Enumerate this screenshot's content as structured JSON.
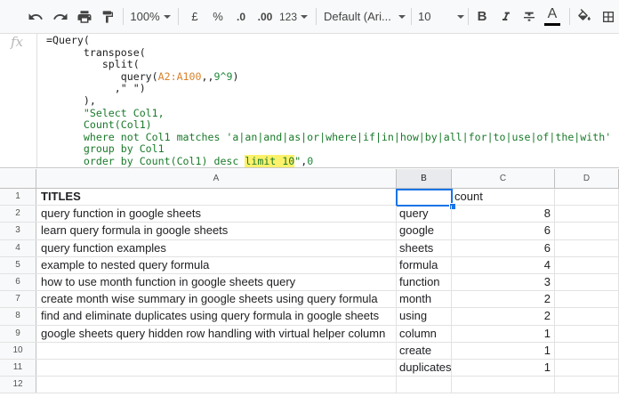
{
  "toolbar": {
    "undo_icon": "undo-icon",
    "redo_icon": "redo-icon",
    "print_icon": "print-icon",
    "paint_format_icon": "paint-format-icon",
    "zoom": "100%",
    "currency": "£",
    "percent": "%",
    "decrease_decimal": ".0",
    "increase_decimal": ".00",
    "more_formats": "123",
    "font_family": "Default (Ari...",
    "font_size": "10",
    "bold_label": "B",
    "text_color_label": "A",
    "accent_color": "#1a73e8"
  },
  "formula_bar": {
    "fx_label": "fx",
    "lines": [
      {
        "parts": [
          {
            "t": "=Query("
          }
        ]
      },
      {
        "parts": [
          {
            "t": "      transpose("
          }
        ]
      },
      {
        "parts": [
          {
            "t": "         split("
          }
        ]
      },
      {
        "parts": [
          {
            "t": "            query("
          },
          {
            "t": "A2:A100",
            "c": "f-range"
          },
          {
            "t": ",,"
          },
          {
            "t": "9^9",
            "c": "f-num"
          },
          {
            "t": ")"
          }
        ]
      },
      {
        "parts": [
          {
            "t": "           ,\" \")"
          }
        ]
      },
      {
        "parts": [
          {
            "t": "      ),"
          }
        ]
      },
      {
        "parts": [
          {
            "t": "      \"Select Col1,",
            "c": "f-str"
          }
        ]
      },
      {
        "parts": [
          {
            "t": "      Count(Col1)",
            "c": "f-str"
          }
        ]
      },
      {
        "parts": [
          {
            "t": "      where not Col1 matches 'a|an|and|as|or|where|if|in|how|by|all|for|to|use|of|the|with'",
            "c": "f-str"
          }
        ]
      },
      {
        "parts": [
          {
            "t": "      group by Col1",
            "c": "f-str"
          }
        ]
      },
      {
        "parts": [
          {
            "t": "      order by Count(Col1) desc ",
            "c": "f-str"
          },
          {
            "t": "limit 10",
            "c": "f-str f-hl"
          },
          {
            "t": "\"",
            "c": "f-str"
          },
          {
            "t": ","
          },
          {
            "t": "0",
            "c": "f-num"
          }
        ]
      },
      {
        "parts": [
          {
            "t": ")"
          }
        ]
      }
    ]
  },
  "columns": [
    "A",
    "B",
    "C",
    "D"
  ],
  "rows": [
    {
      "num": "1",
      "a": "TITLES",
      "b": "",
      "c": "count",
      "header": true
    },
    {
      "num": "2",
      "a": "query function in google sheets",
      "b": "query",
      "c": "8"
    },
    {
      "num": "3",
      "a": "learn query formula in google sheets",
      "b": "google",
      "c": "6"
    },
    {
      "num": "4",
      "a": "query function examples",
      "b": "sheets",
      "c": "6"
    },
    {
      "num": "5",
      "a": "example to nested query formula",
      "b": "formula",
      "c": "4"
    },
    {
      "num": "6",
      "a": "how to use month function in google sheets query",
      "b": "function",
      "c": "3"
    },
    {
      "num": "7",
      "a": "create month wise summary in google sheets using query formula",
      "b": "month",
      "c": "2"
    },
    {
      "num": "8",
      "a": "find and eliminate duplicates using query formula in google sheets",
      "b": "using",
      "c": "2"
    },
    {
      "num": "9",
      "a": "google sheets query hidden row handling with virtual helper column",
      "b": "column",
      "c": "1"
    },
    {
      "num": "10",
      "a": "",
      "b": "create",
      "c": "1"
    },
    {
      "num": "11",
      "a": "",
      "b": "duplicates",
      "c": "1"
    },
    {
      "num": "12",
      "a": "",
      "b": "",
      "c": ""
    }
  ]
}
